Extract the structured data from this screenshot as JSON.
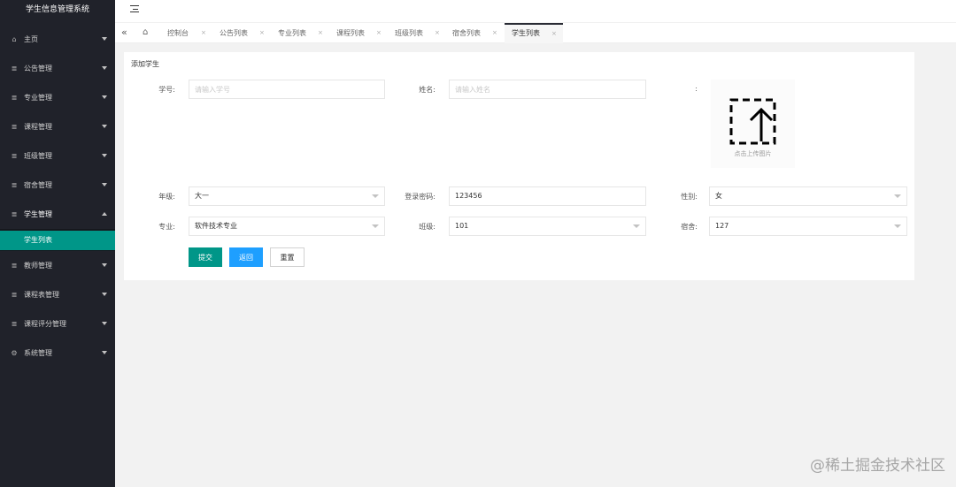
{
  "app": {
    "title": "学生信息管理系统"
  },
  "sidebar": {
    "items": [
      {
        "label": "主页",
        "icon": "home-icon"
      },
      {
        "label": "公告管理",
        "icon": "list-icon"
      },
      {
        "label": "专业管理",
        "icon": "list-icon"
      },
      {
        "label": "课程管理",
        "icon": "list-icon"
      },
      {
        "label": "班级管理",
        "icon": "list-icon"
      },
      {
        "label": "宿舍管理",
        "icon": "list-icon"
      },
      {
        "label": "学生管理",
        "icon": "list-icon",
        "expanded": true
      },
      {
        "label": "教师管理",
        "icon": "list-icon"
      },
      {
        "label": "课程表管理",
        "icon": "list-icon"
      },
      {
        "label": "课程评分管理",
        "icon": "list-icon"
      },
      {
        "label": "系统管理",
        "icon": "gear-icon"
      }
    ],
    "sub_active": "学生列表"
  },
  "tabs": [
    {
      "label": "控制台",
      "close": "×"
    },
    {
      "label": "公告列表",
      "close": "×"
    },
    {
      "label": "专业列表",
      "close": "×"
    },
    {
      "label": "课程列表",
      "close": "×"
    },
    {
      "label": "班级列表",
      "close": "×"
    },
    {
      "label": "宿舍列表",
      "close": "×"
    },
    {
      "label": "学生列表",
      "close": "×",
      "active": true
    }
  ],
  "form": {
    "title": "添加学生",
    "student_id": {
      "label": "学号:",
      "placeholder": "请输入学号",
      "value": ""
    },
    "name": {
      "label": "姓名:",
      "placeholder": "请输入姓名",
      "value": ""
    },
    "photo": {
      "label": ":",
      "upload_text": "点击上传图片"
    },
    "grade": {
      "label": "年级:",
      "value": "大一"
    },
    "password": {
      "label": "登录密码:",
      "value": "123456"
    },
    "gender": {
      "label": "性别:",
      "value": "女"
    },
    "major": {
      "label": "专业:",
      "value": "软件技术专业"
    },
    "class": {
      "label": "班级:",
      "value": "101"
    },
    "dorm": {
      "label": "宿舍:",
      "value": "127"
    },
    "buttons": {
      "submit": "提交",
      "back": "返回",
      "reset": "重置"
    }
  },
  "watermark": "@稀土掘金技术社区",
  "colors": {
    "sidebar": "#20222a",
    "accent": "#009688",
    "blue": "#1e9fff"
  }
}
